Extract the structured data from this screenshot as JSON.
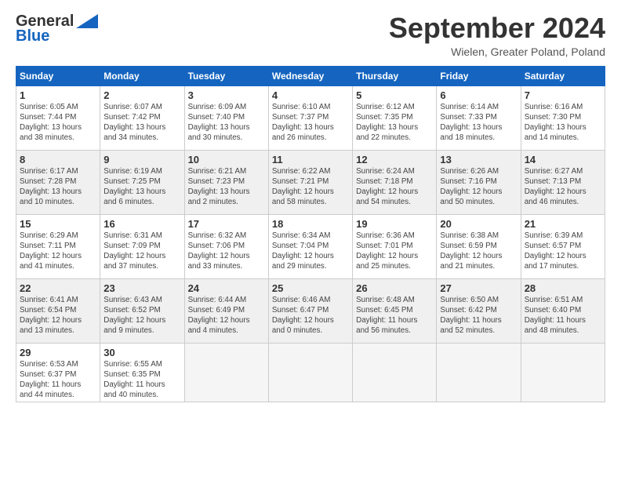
{
  "logo": {
    "general": "General",
    "blue": "Blue"
  },
  "title": "September 2024",
  "location": "Wielen, Greater Poland, Poland",
  "days_of_week": [
    "Sunday",
    "Monday",
    "Tuesday",
    "Wednesday",
    "Thursday",
    "Friday",
    "Saturday"
  ],
  "weeks": [
    [
      {
        "day": 1,
        "info": "Sunrise: 6:05 AM\nSunset: 7:44 PM\nDaylight: 13 hours\nand 38 minutes."
      },
      {
        "day": 2,
        "info": "Sunrise: 6:07 AM\nSunset: 7:42 PM\nDaylight: 13 hours\nand 34 minutes."
      },
      {
        "day": 3,
        "info": "Sunrise: 6:09 AM\nSunset: 7:40 PM\nDaylight: 13 hours\nand 30 minutes."
      },
      {
        "day": 4,
        "info": "Sunrise: 6:10 AM\nSunset: 7:37 PM\nDaylight: 13 hours\nand 26 minutes."
      },
      {
        "day": 5,
        "info": "Sunrise: 6:12 AM\nSunset: 7:35 PM\nDaylight: 13 hours\nand 22 minutes."
      },
      {
        "day": 6,
        "info": "Sunrise: 6:14 AM\nSunset: 7:33 PM\nDaylight: 13 hours\nand 18 minutes."
      },
      {
        "day": 7,
        "info": "Sunrise: 6:16 AM\nSunset: 7:30 PM\nDaylight: 13 hours\nand 14 minutes."
      }
    ],
    [
      {
        "day": 8,
        "info": "Sunrise: 6:17 AM\nSunset: 7:28 PM\nDaylight: 13 hours\nand 10 minutes."
      },
      {
        "day": 9,
        "info": "Sunrise: 6:19 AM\nSunset: 7:25 PM\nDaylight: 13 hours\nand 6 minutes."
      },
      {
        "day": 10,
        "info": "Sunrise: 6:21 AM\nSunset: 7:23 PM\nDaylight: 13 hours\nand 2 minutes."
      },
      {
        "day": 11,
        "info": "Sunrise: 6:22 AM\nSunset: 7:21 PM\nDaylight: 12 hours\nand 58 minutes."
      },
      {
        "day": 12,
        "info": "Sunrise: 6:24 AM\nSunset: 7:18 PM\nDaylight: 12 hours\nand 54 minutes."
      },
      {
        "day": 13,
        "info": "Sunrise: 6:26 AM\nSunset: 7:16 PM\nDaylight: 12 hours\nand 50 minutes."
      },
      {
        "day": 14,
        "info": "Sunrise: 6:27 AM\nSunset: 7:13 PM\nDaylight: 12 hours\nand 46 minutes."
      }
    ],
    [
      {
        "day": 15,
        "info": "Sunrise: 6:29 AM\nSunset: 7:11 PM\nDaylight: 12 hours\nand 41 minutes."
      },
      {
        "day": 16,
        "info": "Sunrise: 6:31 AM\nSunset: 7:09 PM\nDaylight: 12 hours\nand 37 minutes."
      },
      {
        "day": 17,
        "info": "Sunrise: 6:32 AM\nSunset: 7:06 PM\nDaylight: 12 hours\nand 33 minutes."
      },
      {
        "day": 18,
        "info": "Sunrise: 6:34 AM\nSunset: 7:04 PM\nDaylight: 12 hours\nand 29 minutes."
      },
      {
        "day": 19,
        "info": "Sunrise: 6:36 AM\nSunset: 7:01 PM\nDaylight: 12 hours\nand 25 minutes."
      },
      {
        "day": 20,
        "info": "Sunrise: 6:38 AM\nSunset: 6:59 PM\nDaylight: 12 hours\nand 21 minutes."
      },
      {
        "day": 21,
        "info": "Sunrise: 6:39 AM\nSunset: 6:57 PM\nDaylight: 12 hours\nand 17 minutes."
      }
    ],
    [
      {
        "day": 22,
        "info": "Sunrise: 6:41 AM\nSunset: 6:54 PM\nDaylight: 12 hours\nand 13 minutes."
      },
      {
        "day": 23,
        "info": "Sunrise: 6:43 AM\nSunset: 6:52 PM\nDaylight: 12 hours\nand 9 minutes."
      },
      {
        "day": 24,
        "info": "Sunrise: 6:44 AM\nSunset: 6:49 PM\nDaylight: 12 hours\nand 4 minutes."
      },
      {
        "day": 25,
        "info": "Sunrise: 6:46 AM\nSunset: 6:47 PM\nDaylight: 12 hours\nand 0 minutes."
      },
      {
        "day": 26,
        "info": "Sunrise: 6:48 AM\nSunset: 6:45 PM\nDaylight: 11 hours\nand 56 minutes."
      },
      {
        "day": 27,
        "info": "Sunrise: 6:50 AM\nSunset: 6:42 PM\nDaylight: 11 hours\nand 52 minutes."
      },
      {
        "day": 28,
        "info": "Sunrise: 6:51 AM\nSunset: 6:40 PM\nDaylight: 11 hours\nand 48 minutes."
      }
    ],
    [
      {
        "day": 29,
        "info": "Sunrise: 6:53 AM\nSunset: 6:37 PM\nDaylight: 11 hours\nand 44 minutes."
      },
      {
        "day": 30,
        "info": "Sunrise: 6:55 AM\nSunset: 6:35 PM\nDaylight: 11 hours\nand 40 minutes."
      },
      null,
      null,
      null,
      null,
      null
    ]
  ]
}
